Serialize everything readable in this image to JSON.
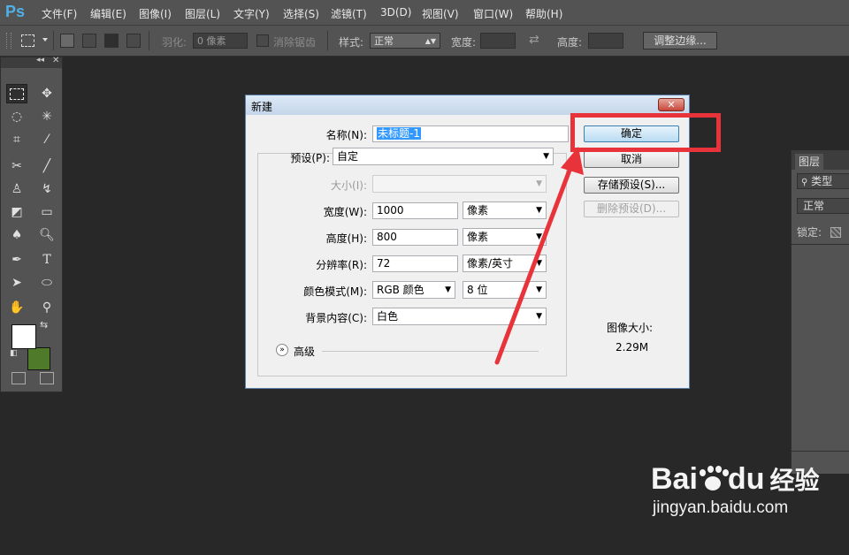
{
  "app": {
    "logo": "Ps",
    "menu": [
      "文件(F)",
      "编辑(E)",
      "图像(I)",
      "图层(L)",
      "文字(Y)",
      "选择(S)",
      "滤镜(T)",
      "3D(D)",
      "视图(V)",
      "窗口(W)",
      "帮助(H)"
    ]
  },
  "options_bar": {
    "feather_label": "羽化:",
    "feather_value": "0 像素",
    "antialias_label": "消除锯齿",
    "style_label": "样式:",
    "style_value": "正常",
    "width_label": "宽度:",
    "height_label": "高度:",
    "refine_edge_button": "调整边缘..."
  },
  "layers_panel": {
    "tab": "图层",
    "filter_label": "类型",
    "blend_mode": "正常",
    "lock_label": "锁定:"
  },
  "dialog": {
    "title": "新建",
    "close_symbol": "✕",
    "name_label": "名称(N):",
    "name_value": "未标题-1",
    "preset_label": "预设(P):",
    "preset_value": "自定",
    "size_label": "大小(I):",
    "width_label": "宽度(W):",
    "width_value": "1000",
    "width_unit": "像素",
    "height_label": "高度(H):",
    "height_value": "800",
    "height_unit": "像素",
    "resolution_label": "分辨率(R):",
    "resolution_value": "72",
    "resolution_unit": "像素/英寸",
    "color_mode_label": "颜色模式(M):",
    "color_mode_value": "RGB 颜色",
    "bit_depth_value": "8 位",
    "background_label": "背景内容(C):",
    "background_value": "白色",
    "advanced_label": "高级",
    "ok_button": "确定",
    "cancel_button": "取消",
    "save_preset_button": "存储预设(S)...",
    "delete_preset_button": "删除预设(D)...",
    "image_size_label": "图像大小:",
    "image_size_value": "2.29M"
  },
  "watermark": {
    "brand_bai": "Bai",
    "brand_du": "du",
    "brand_jingyan": "经验",
    "url": "jingyan.baidu.com"
  },
  "colors": {
    "foreground": "#ffffff",
    "background": "#4e7a2a",
    "annotation": "#e8333a",
    "ps_blue": "#4fb0e8"
  }
}
